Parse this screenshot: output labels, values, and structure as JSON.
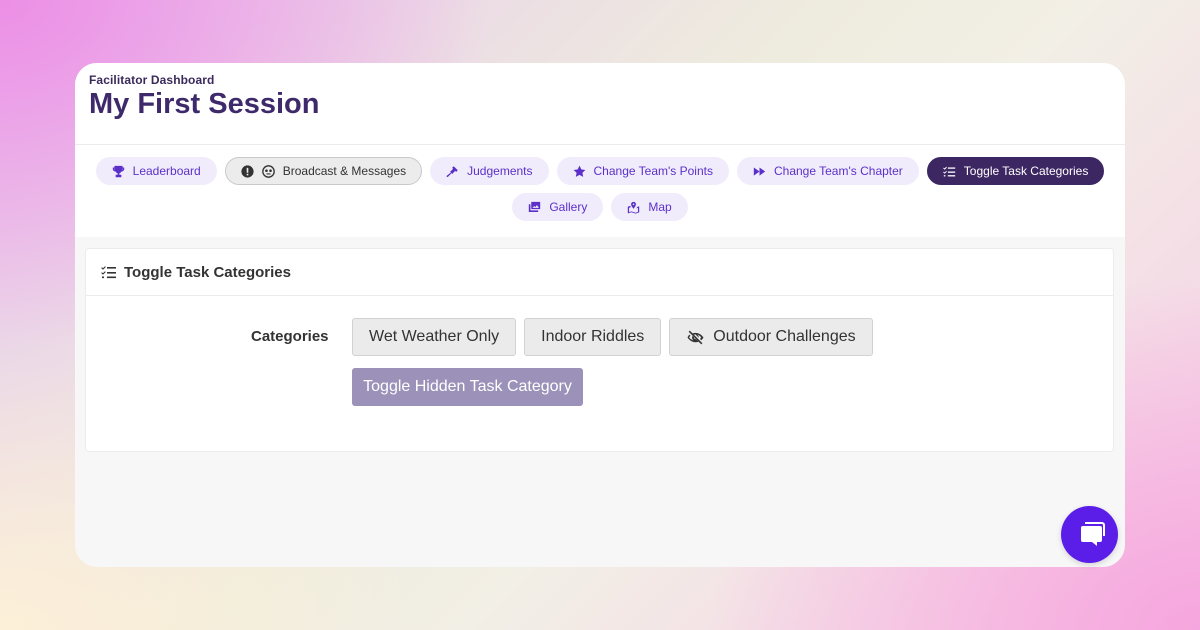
{
  "header": {
    "kicker": "Facilitator Dashboard",
    "title": "My First Session"
  },
  "nav": {
    "row1": [
      {
        "label": "Leaderboard",
        "icon": "trophy-icon",
        "style": "default"
      },
      {
        "label": "Broadcast & Messages",
        "icon": "alert-icon",
        "style": "gray"
      },
      {
        "label": "Judgements",
        "icon": "gavel-icon",
        "style": "default"
      },
      {
        "label": "Change Team's Points",
        "icon": "star-icon",
        "style": "default"
      },
      {
        "label": "Change Team's Chapter",
        "icon": "fast-forward-icon",
        "style": "default"
      },
      {
        "label": "Toggle Task Categories",
        "icon": "list-check-icon",
        "style": "active"
      }
    ],
    "row2": [
      {
        "label": "Gallery",
        "icon": "gallery-icon",
        "style": "default"
      },
      {
        "label": "Map",
        "icon": "map-icon",
        "style": "default"
      }
    ]
  },
  "panel": {
    "title": "Toggle Task Categories",
    "categories_label": "Categories",
    "categories": [
      {
        "label": "Wet Weather Only",
        "hidden": false
      },
      {
        "label": "Indoor Riddles",
        "hidden": false
      },
      {
        "label": "Outdoor Challenges",
        "hidden": true
      }
    ],
    "toggle_button": "Toggle Hidden Task Category"
  },
  "colors": {
    "accent": "#5b30c8",
    "active_pill": "#3c2763",
    "title": "#3e2a6b",
    "toggle_button": "#9b91b9",
    "chat_button": "#5b1ee8"
  }
}
